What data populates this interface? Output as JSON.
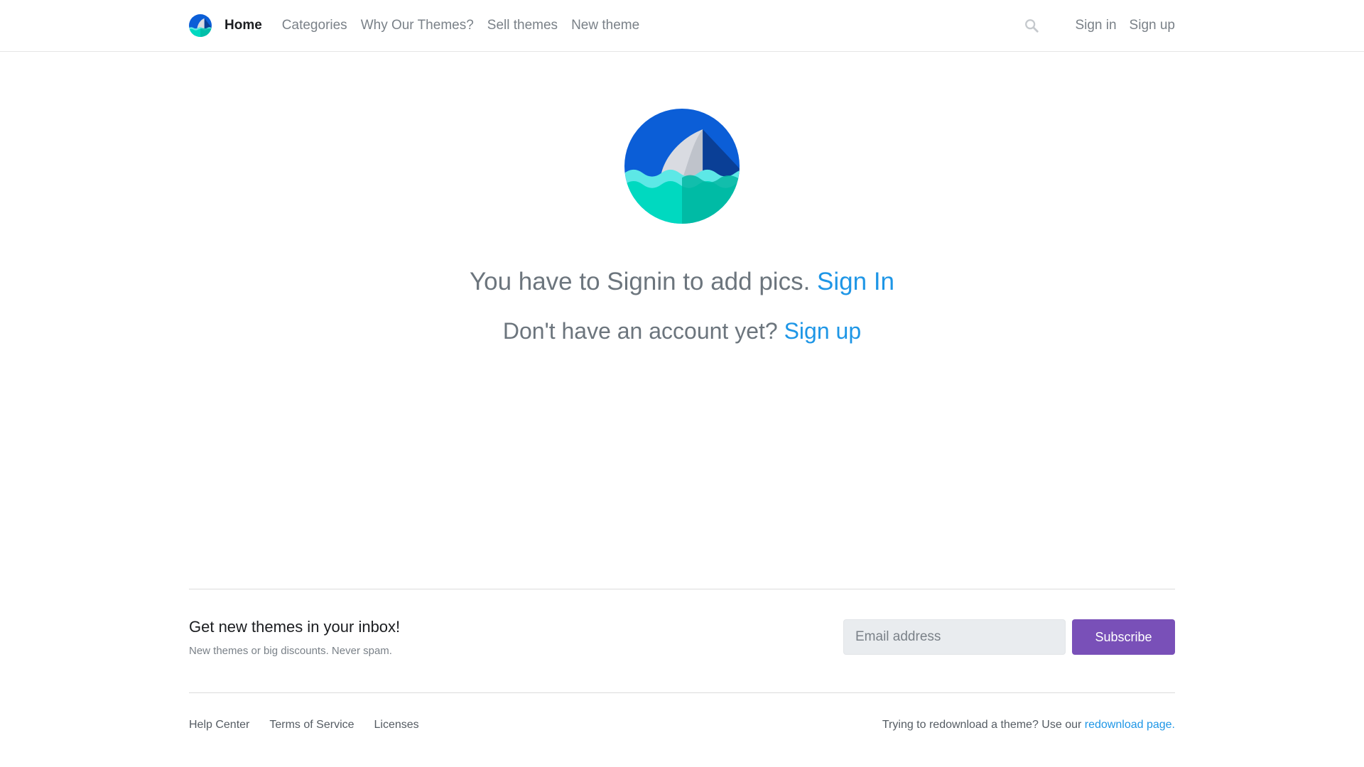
{
  "nav": {
    "items": [
      {
        "label": "Home"
      },
      {
        "label": "Categories"
      },
      {
        "label": "Why Our Themes?"
      },
      {
        "label": "Sell themes"
      },
      {
        "label": "New theme"
      }
    ],
    "sign_in": "Sign in",
    "sign_up": "Sign up",
    "search_icon": "search-icon"
  },
  "main": {
    "message_text": "You have to Signin to add pics.",
    "message_link": "Sign In",
    "account_text": "Don't have an account yet?",
    "account_link": "Sign up"
  },
  "newsletter": {
    "title": "Get new themes in your inbox!",
    "subtitle": "New themes or big discounts. Never spam.",
    "email_placeholder": "Email address",
    "subscribe_label": "Subscribe"
  },
  "footer": {
    "links": [
      {
        "label": "Help Center"
      },
      {
        "label": "Terms of Service"
      },
      {
        "label": "Licenses"
      }
    ],
    "redownload_text": "Trying to redownload a theme? Use our",
    "redownload_link": "redownload page."
  },
  "colors": {
    "accent_link": "#1e96e6",
    "subscribe_button": "#7950b8",
    "logo_blue": "#0b5ed7",
    "logo_teal": "#00d9c0"
  }
}
